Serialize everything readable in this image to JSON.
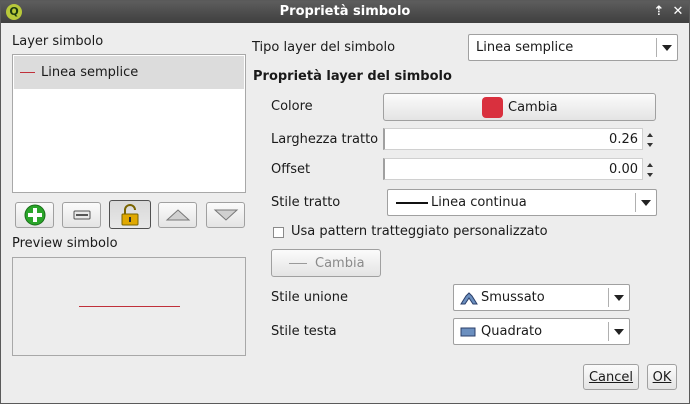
{
  "window": {
    "title": "Proprietà simbolo",
    "app_icon_letter": "Q"
  },
  "left": {
    "layer_label": "Layer simbolo",
    "layer_items": [
      "Linea semplice"
    ],
    "preview_label": "Preview simbolo"
  },
  "right": {
    "symbol_type_label": "Tipo layer del simbolo",
    "symbol_type_value": "Linea semplice",
    "section_title": "Proprietà layer del simbolo",
    "color_label": "Colore",
    "color_button_label": "Cambia",
    "color_value": "#d9303e",
    "width_label": "Larghezza tratto",
    "width_value": "0.26",
    "offset_label": "Offset",
    "offset_value": "0.00",
    "pen_style_label": "Stile tratto",
    "pen_style_value": "Linea continua",
    "custom_dash_label": "Usa pattern tratteggiato personalizzato",
    "custom_dash_checked": false,
    "dash_button_label": "Cambia",
    "join_style_label": "Stile unione",
    "join_style_value": "Smussato",
    "cap_style_label": "Stile testa",
    "cap_style_value": "Quadrato"
  },
  "footer": {
    "cancel_label": "Cancel",
    "ok_label": "OK"
  },
  "colors": {
    "line_color": "#c0303a",
    "titlebar": "#4a4a4a",
    "add_icon": "#2aa52a",
    "lock_icon": "#e0a800"
  }
}
